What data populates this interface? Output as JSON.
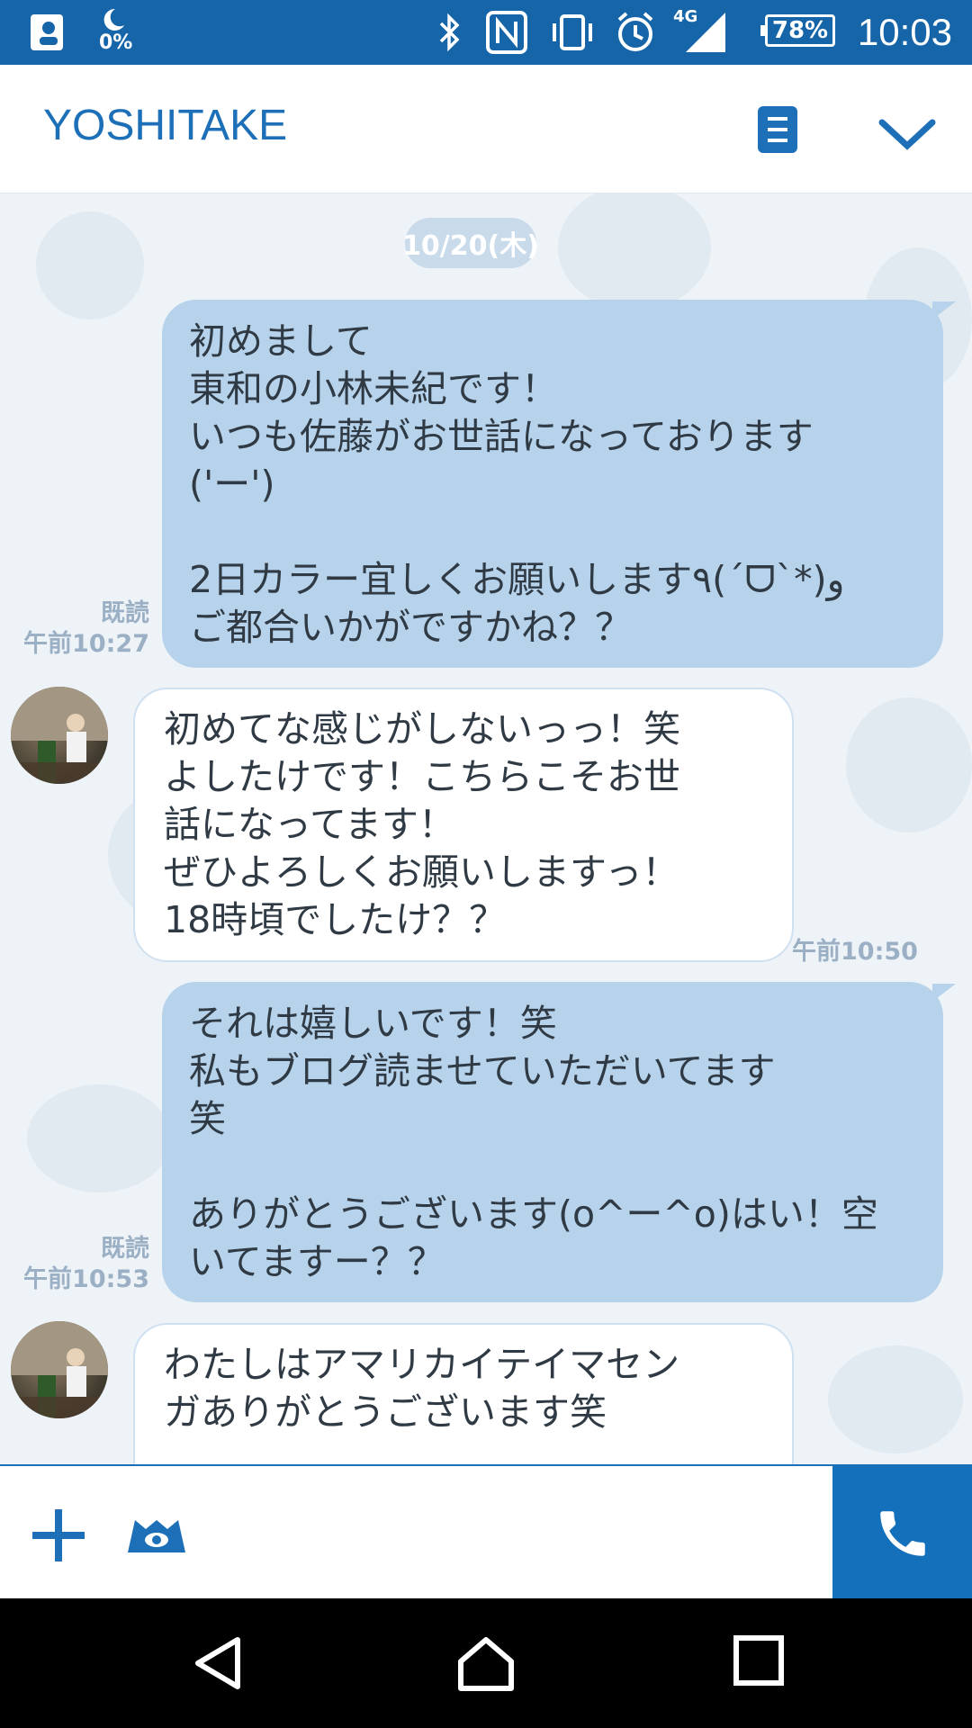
{
  "status_bar": {
    "time": "10:03",
    "battery": "78%",
    "network": "4G",
    "data_usage": "0%",
    "icons": [
      "contacts-icon",
      "night-mode-icon",
      "bluetooth-icon",
      "nfc-icon",
      "vibrate-icon",
      "alarm-icon",
      "signal-icon",
      "battery-icon"
    ]
  },
  "header": {
    "title": "YOSHITAKE",
    "menu_icon": "menu-icon",
    "expand_icon": "chevron-down-icon"
  },
  "chat": {
    "date_label": "10/20(木)",
    "read_label": "既読",
    "messages": [
      {
        "direction": "out",
        "text": "初めまして  \n東和の小林未紀です！\nいつも佐藤がお世話になっております\n('ー')\n\n2日カラー宜しくお願いします٩(ˊᗜˋ*)و\nご都合いかがですかね？？",
        "read": "既読",
        "time": "午前10:27"
      },
      {
        "direction": "in",
        "text": "初めてな感じがしないっっ！笑\nよしたけです！こちらこそお世\n話になってます！\nぜひよろしくお願いしますっ！\n18時頃でしたけ？？",
        "time": "午前10:50"
      },
      {
        "direction": "out",
        "text": "それは嬉しいです！笑\n私もブログ読ませていただいてます\n笑\n\nありがとうございます(o^ー^o)はい！空\nいてますー？？",
        "read": "既読",
        "time": "午前10:53"
      },
      {
        "direction": "in",
        "text": "わたしはアマリカイテイマセン\nガありがとうございます笑"
      }
    ]
  },
  "input_bar": {
    "add_icon": "plus-icon",
    "sticker_icon": "sticker-icon",
    "call_icon": "phone-icon"
  },
  "nav_bar": {
    "icons": [
      "back-icon",
      "home-icon",
      "recents-icon"
    ]
  },
  "colors": {
    "accent": "#1d70b8",
    "status_bar": "#1565a8",
    "outgoing_bubble": "#b7d3ec",
    "incoming_bubble": "#ffffff",
    "chat_background": "#eef3f8"
  }
}
